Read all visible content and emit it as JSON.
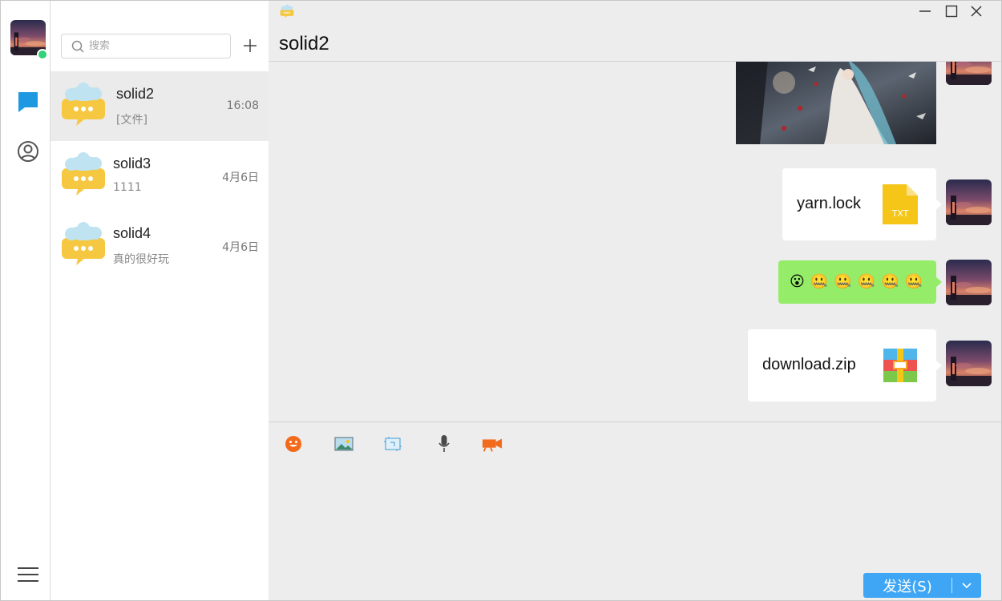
{
  "search": {
    "placeholder": "搜索"
  },
  "conversations": [
    {
      "name": "solid2",
      "preview": "[文件]",
      "time": "16:08"
    },
    {
      "name": "solid3",
      "preview": "1111",
      "time": "4月6日"
    },
    {
      "name": "solid4",
      "preview": "真的很好玩",
      "time": "4月6日"
    }
  ],
  "chat": {
    "title": "solid2",
    "messages": [
      {
        "type": "image"
      },
      {
        "type": "file",
        "filename": "yarn.lock",
        "file_badge": "TXT",
        "icon": "txt-file-icon"
      },
      {
        "type": "emoji",
        "emojis": [
          "😮",
          "🤐",
          "🤐",
          "🤐",
          "🤐",
          "🤐"
        ]
      },
      {
        "type": "file",
        "filename": "download.zip",
        "icon": "zip-archive-icon"
      }
    ]
  },
  "composer": {
    "tools": [
      "emoji-icon",
      "image-icon",
      "screenshot-icon",
      "microphone-icon",
      "video-camera-icon"
    ],
    "send_label": "发送(S)"
  },
  "colors": {
    "accent": "#3ea6f5",
    "online": "#33d17a",
    "self_bubble": "#95ec69",
    "chat_bg": "#ededed",
    "active_conv": "#ebebeb"
  }
}
